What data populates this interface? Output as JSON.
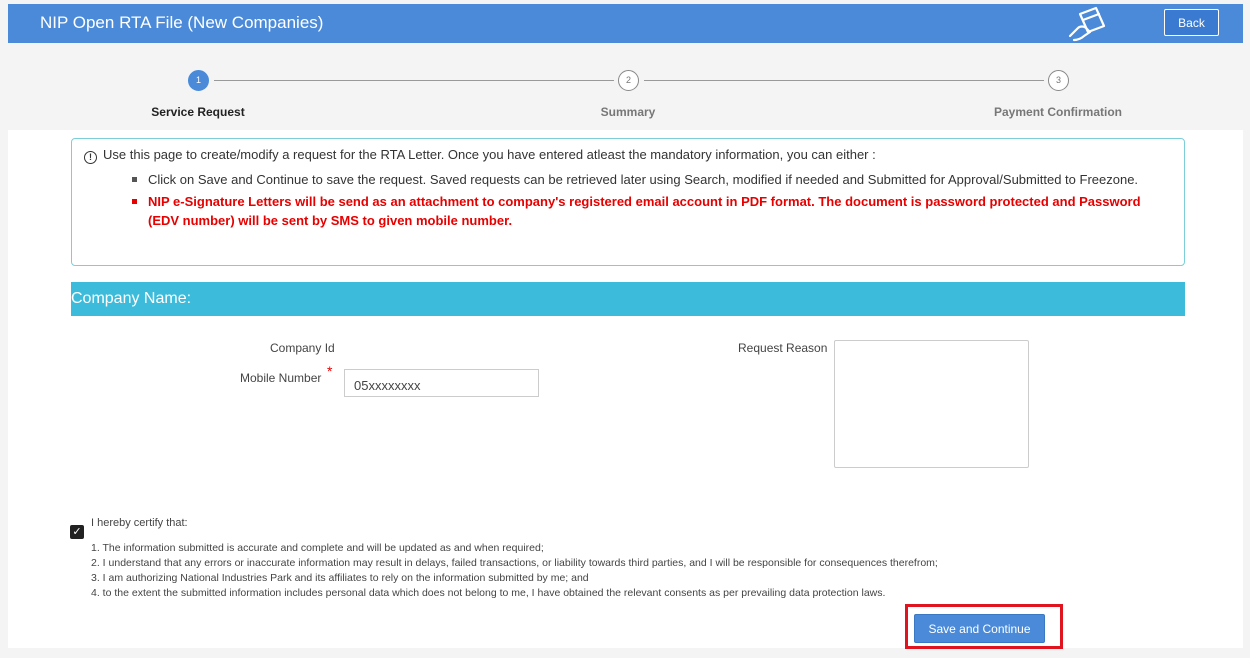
{
  "header": {
    "title": "NIP Open RTA File (New Companies)",
    "back_label": "Back",
    "icon": "card-payment-icon"
  },
  "steps": [
    {
      "number": "1",
      "label": "Service Request",
      "active": true
    },
    {
      "number": "2",
      "label": "Summary",
      "active": false
    },
    {
      "number": "3",
      "label": "Payment Confirmation",
      "active": false
    }
  ],
  "info": {
    "intro": "Use this page to create/modify a request for the RTA Letter. Once you have entered atleast the mandatory information, you can either :",
    "bullet1": "Click on Save and Continue to save the request. Saved requests can be retrieved later using Search, modified if needed and Submitted for Approval/Submitted to Freezone.",
    "bullet2": "NIP e-Signature Letters will be send as an attachment to company's registered email account in PDF format. The document is password protected and Password (EDV number) will be sent by SMS to given mobile number."
  },
  "section": {
    "title": "Company Name:"
  },
  "form": {
    "company_id_label": "Company Id",
    "mobile_label": "Mobile Number",
    "mobile_required": "*",
    "mobile_value": "05xxxxxxxx",
    "request_reason_label": "Request Reason",
    "request_reason_value": ""
  },
  "certification": {
    "checked": true,
    "title": "I hereby certify that:",
    "items": [
      "1. The information submitted is accurate and complete and will be updated as and when required;",
      "2. I understand that any errors or inaccurate information may result in delays, failed transactions, or liability towards third parties, and I will be responsible for consequences therefrom;",
      "3. I am authorizing National Industries Park and its affiliates to rely on the information submitted by me; and",
      "4. to the extent the submitted information includes personal data which does not belong to me, I have obtained the relevant consents as per prevailing data protection laws."
    ]
  },
  "actions": {
    "save_label": "Save and Continue"
  },
  "colors": {
    "header": "#4a8ad8",
    "section": "#3dbbda",
    "warning": "#e60000",
    "highlight": "#e0141e"
  }
}
